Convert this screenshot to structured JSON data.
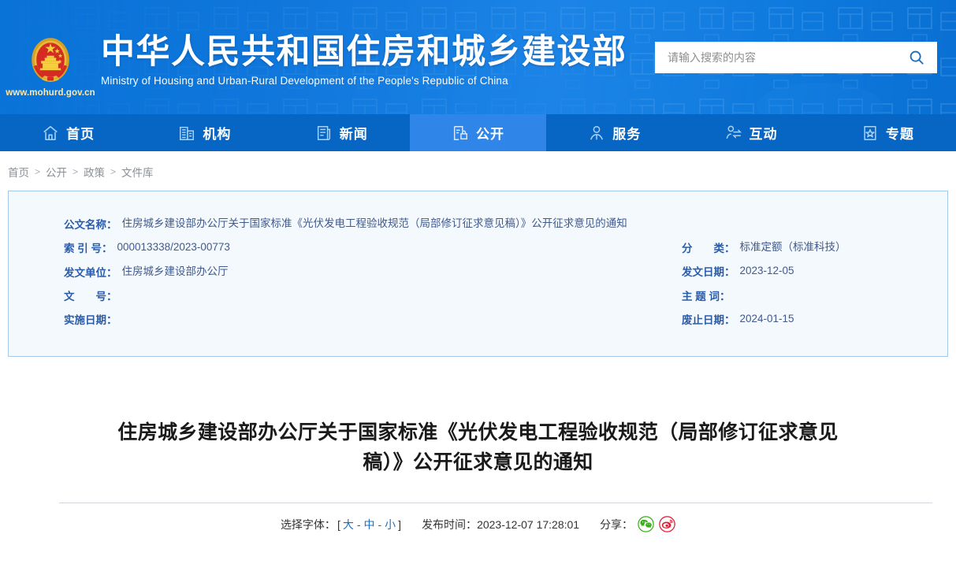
{
  "header": {
    "emblem_icon": "china-national-emblem",
    "site_url": "www.mohurd.gov.cn",
    "title_cn": "中华人民共和国住房和城乡建设部",
    "title_en": "Ministry of Housing and Urban-Rural Development of the People's Republic of China",
    "search": {
      "placeholder": "请输入搜索的内容",
      "value": "",
      "button_icon": "search-icon"
    }
  },
  "nav": {
    "items": [
      {
        "label": "首页",
        "icon": "home-icon",
        "active": false
      },
      {
        "label": "机构",
        "icon": "building-icon",
        "active": false
      },
      {
        "label": "新闻",
        "icon": "news-icon",
        "active": false
      },
      {
        "label": "公开",
        "icon": "open-document-lock-icon",
        "active": true
      },
      {
        "label": "服务",
        "icon": "service-person-icon",
        "active": false
      },
      {
        "label": "互动",
        "icon": "interaction-exchange-icon",
        "active": false
      },
      {
        "label": "专题",
        "icon": "star-topic-icon",
        "active": false
      }
    ]
  },
  "breadcrumb": {
    "items": [
      "首页",
      "公开",
      "政策",
      "文件库"
    ],
    "separator": ">"
  },
  "info_panel": {
    "left": [
      {
        "label": "公文名称：",
        "value": "住房城乡建设部办公厅关于国家标准《光伏发电工程验收规范（局部修订征求意见稿）》公开征求意见的通知"
      },
      {
        "label": "索 引 号：",
        "value": "000013338/2023-00773"
      },
      {
        "label": "发文单位：",
        "value": "住房城乡建设部办公厅"
      },
      {
        "label": "文　　号：",
        "value": ""
      },
      {
        "label": "实施日期：",
        "value": ""
      }
    ],
    "right": [
      {
        "label": "分　　类：",
        "value": "标准定额（标准科技）"
      },
      {
        "label": "发文日期：",
        "value": "2023-12-05"
      },
      {
        "label": "主 题 词：",
        "value": ""
      },
      {
        "label": "废止日期：",
        "value": "2024-01-15"
      }
    ]
  },
  "article": {
    "title": "住房城乡建设部办公厅关于国家标准《光伏发电工程验收规范（局部修订征求意见稿）》公开征求意见的通知",
    "font_choose_label": "选择字体：",
    "bracket_open": "[",
    "bracket_close": "]",
    "font_sizes": [
      "大",
      "中",
      "小"
    ],
    "font_separator": "-",
    "publish_label": "发布时间：",
    "publish_time": "2023-12-07 17:28:01",
    "share_label": "分享：",
    "share_icons": [
      {
        "name": "wechat-share-icon",
        "color": "#38ad19"
      },
      {
        "name": "weibo-share-icon",
        "color": "#e6162d"
      }
    ]
  },
  "colors": {
    "header_blue": "#1178dd",
    "nav_blue": "#0765c4",
    "nav_active_blue": "#2f86e8",
    "panel_bg": "#f4f9fe",
    "panel_border": "#a5c9ea",
    "label_blue": "#2a5caa",
    "value_blue": "#41598b",
    "link_blue": "#1a6fc4"
  }
}
